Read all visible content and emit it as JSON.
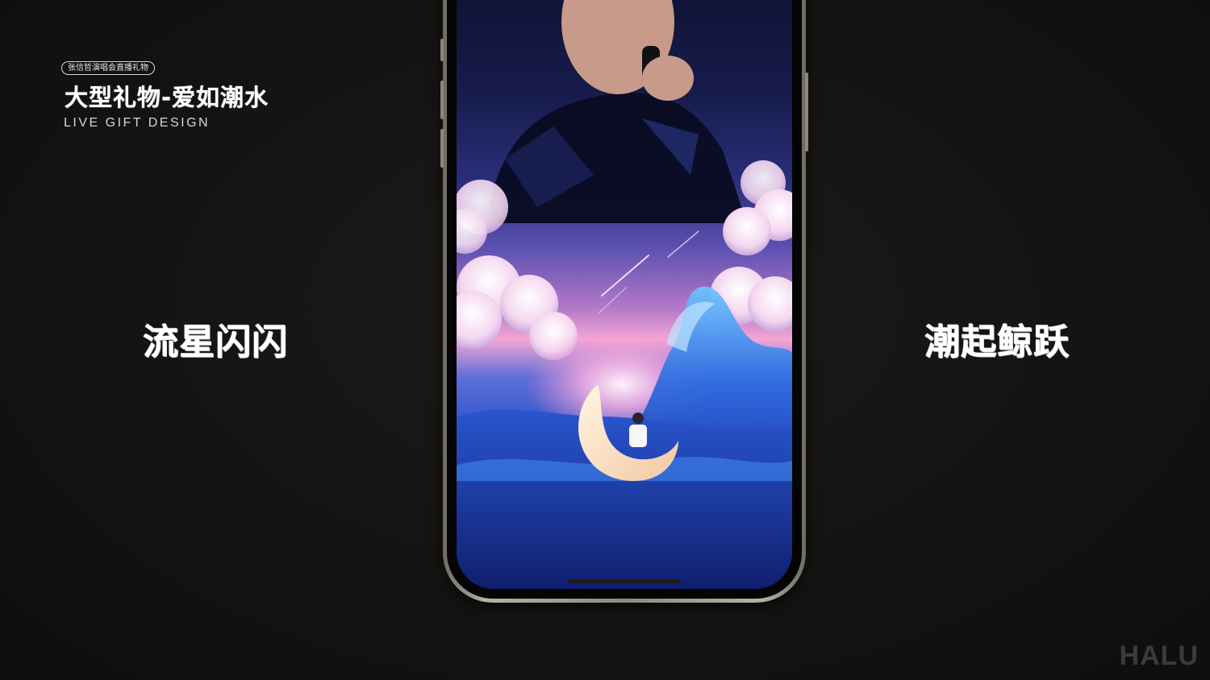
{
  "header": {
    "badge": "张信哲演唱会直播礼物",
    "title": "大型礼物-爱如潮水",
    "subtitle": "LIVE GIFT DESIGN"
  },
  "captions": {
    "left": "流星闪闪",
    "right": "潮起鲸跃"
  },
  "watermark": "HALU",
  "colors": {
    "background": "#141312",
    "phone_frame": "#b8b2a6",
    "text": "#ffffff"
  }
}
